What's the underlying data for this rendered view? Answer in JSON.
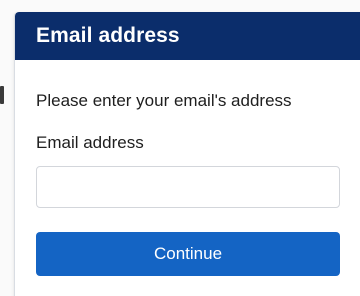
{
  "dialog": {
    "title": "Email address",
    "instruction": "Please enter your email's address",
    "email_label": "Email address",
    "email_value": "",
    "email_placeholder": "",
    "continue_label": "Continue"
  },
  "colors": {
    "header_background": "#0b2d6b",
    "button_background": "#1464c4",
    "text": "#1e1e1e"
  }
}
